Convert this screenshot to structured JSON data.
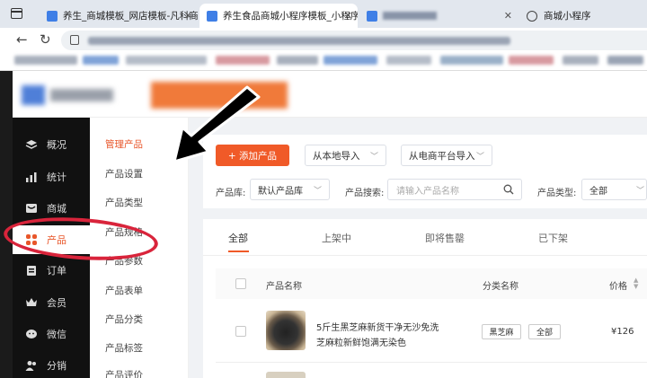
{
  "browser": {
    "tabs": [
      {
        "label": "养生_商城模板_网店模板-凡科商城",
        "active": false
      },
      {
        "label": "养生食品商城小程序模板_小程序模板",
        "active": true
      },
      {
        "label": "",
        "active": false
      },
      {
        "label": "商城小程序",
        "active": false
      }
    ]
  },
  "sidebar": {
    "items": [
      {
        "label": "概况",
        "icon": "layers-icon",
        "active": false
      },
      {
        "label": "统计",
        "icon": "chart-icon",
        "active": false
      },
      {
        "label": "商城",
        "icon": "store-icon",
        "active": false
      },
      {
        "label": "产品",
        "icon": "flower-icon",
        "active": true
      },
      {
        "label": "订单",
        "icon": "order-icon",
        "active": false
      },
      {
        "label": "会员",
        "icon": "crown-icon",
        "active": false
      },
      {
        "label": "微信",
        "icon": "wechat-icon",
        "active": false
      },
      {
        "label": "分销",
        "icon": "users-icon",
        "active": false
      }
    ]
  },
  "submenu": {
    "items": [
      "管理产品",
      "产品设置",
      "产品类型",
      "产品规格",
      "产品参数",
      "产品表单",
      "产品分类",
      "产品标签",
      "产品评价"
    ]
  },
  "toolbar": {
    "add_label": "+ 添加产品",
    "import_local": "从本地导入",
    "import_platform": "从电商平台导入"
  },
  "filters": {
    "library_label": "产品库:",
    "library_value": "默认产品库",
    "search_label": "产品搜索:",
    "search_placeholder": "请输入产品名称",
    "type_label": "产品类型:",
    "type_value": "全部"
  },
  "status_tabs": [
    "全部",
    "上架中",
    "即将售罄",
    "已下架"
  ],
  "table": {
    "headers": {
      "name": "产品名称",
      "category": "分类名称",
      "price": "价格"
    },
    "rows": [
      {
        "name_line1": "5斤生黑芝麻新货干净无沙免洗",
        "name_line2": "芝麻粒新鲜饱满无染色",
        "tags": [
          "黑芝麻",
          "全部"
        ],
        "price": "¥126"
      }
    ]
  },
  "colors": {
    "accent": "#f05a28",
    "sidebar_bg": "#111111",
    "annotation": "#d9243b"
  }
}
